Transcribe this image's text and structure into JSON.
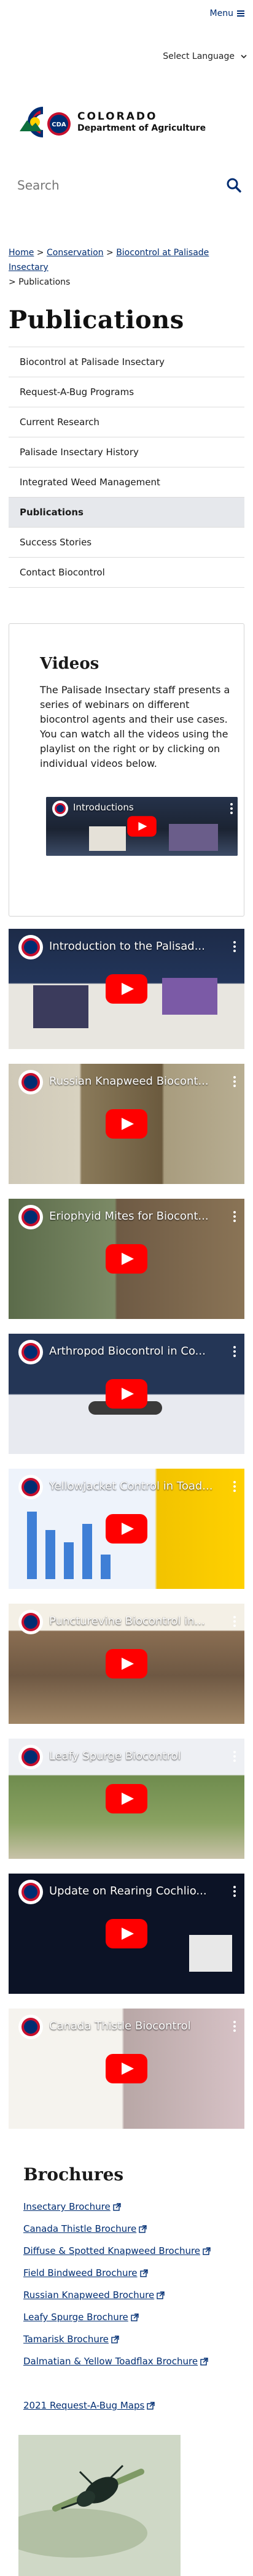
{
  "header": {
    "menu_label": "Menu",
    "language_label": "Select Language",
    "logo": {
      "state": "COLORADO",
      "department": "Department of Agriculture",
      "badge_text": "CDA"
    },
    "search_placeholder": "Search"
  },
  "breadcrumb": {
    "items": [
      "Home",
      "Conservation",
      "Biocontrol at Palisade Insectary"
    ],
    "current": "Publications",
    "separator": ">"
  },
  "page_title": "Publications",
  "sidenav": {
    "items": [
      {
        "label": "Biocontrol at Palisade Insectary",
        "active": false
      },
      {
        "label": "Request-A-Bug Programs",
        "active": false
      },
      {
        "label": "Current Research",
        "active": false
      },
      {
        "label": "Palisade Insectary History",
        "active": false
      },
      {
        "label": "Integrated Weed Management",
        "active": false
      },
      {
        "label": "Publications",
        "active": true
      },
      {
        "label": "Success Stories",
        "active": false
      },
      {
        "label": "Contact Biocontrol",
        "active": false
      }
    ]
  },
  "videos": {
    "title": "Videos",
    "description": "The Palisade Insectary staff presents a series of webinars on different biocontrol agents and their use cases. You can watch all the videos using the playlist on the right or by clicking on individual videos below.",
    "playlist_title": "Introductions",
    "items": [
      {
        "title": "Introduction to the Palisad..."
      },
      {
        "title": "Russian Knapweed Biocont..."
      },
      {
        "title": "Eriophyid Mites for Biocont..."
      },
      {
        "title": "Arthropod Biocontrol in Co..."
      },
      {
        "title": "Yellowjacket Control in Toad..."
      },
      {
        "title": "Puncturevine Biocontrol in..."
      },
      {
        "title": "Leafy Spurge Biocontrol"
      },
      {
        "title": "Update on Rearing Cochlio..."
      },
      {
        "title": "Canada Thistle Biocontrol"
      }
    ]
  },
  "brochures": {
    "title": "Brochures",
    "links": [
      "Insectary Brochure",
      "Canada Thistle Brochure",
      "Diffuse & Spotted Knapweed Brochure",
      "Field Bindweed Brochure",
      "Russian Knapweed Brochure",
      "Leafy Spurge Brochure",
      "Tamarisk Brochure",
      "Dalmatian & Yellow Toadflax Brochure"
    ],
    "request_link": "2021 Request-A-Bug Maps"
  },
  "colors": {
    "brand_blue": "#002d72",
    "brand_red": "#c8102e",
    "brand_gold": "#ffd100",
    "youtube_red": "#ff0000",
    "active_nav_bg": "#e6e8ec"
  }
}
